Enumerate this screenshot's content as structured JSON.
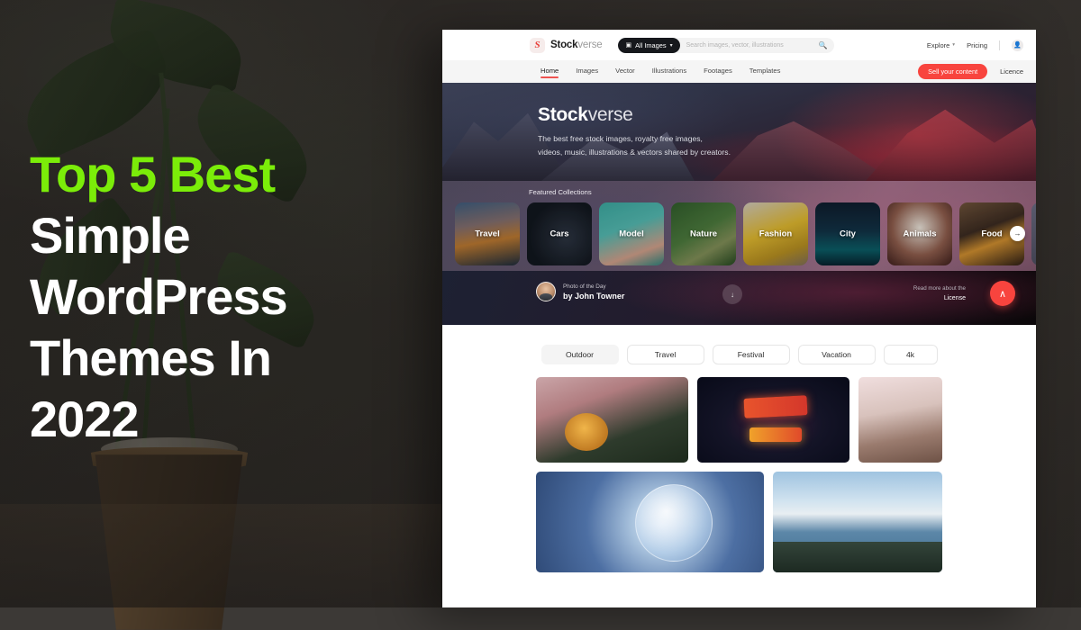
{
  "overlay": {
    "headline_line1": "Top 5 Best",
    "headline_line2": "Simple",
    "headline_line3": "WordPress",
    "headline_line4": "Themes In",
    "headline_line5": "2022",
    "accent_color": "#7bed09",
    "text_color": "#ffffff"
  },
  "site": {
    "brand_bold": "Stock",
    "brand_light": "verse",
    "logo_glyph": "S"
  },
  "search": {
    "category_label": "All Images",
    "category_icon": "camera-icon",
    "caret_icon": "▾",
    "placeholder": "Search images, vector, illustrations",
    "search_icon": "⚲"
  },
  "topbar": {
    "explore_label": "Explore",
    "pricing_label": "Pricing",
    "account_icon": "user-icon",
    "caret_icon": "▾"
  },
  "nav": {
    "items": [
      {
        "label": "Home",
        "active": true
      },
      {
        "label": "Images",
        "active": false
      },
      {
        "label": "Vector",
        "active": false
      },
      {
        "label": "Illustrations",
        "active": false
      },
      {
        "label": "Footages",
        "active": false
      },
      {
        "label": "Templates",
        "active": false
      }
    ],
    "sell_button": "Sell your content",
    "licence_link": "Licence",
    "accent_color": "#f8443e"
  },
  "hero": {
    "title_bold": "Stock",
    "title_thin": "verse",
    "subtitle_line1": "The best free stock images, royalty free images,",
    "subtitle_line2": "videos, music, illustrations & vectors shared by creators."
  },
  "collections": {
    "label": "Featured Collections",
    "next_icon": "→",
    "items": [
      {
        "caption": "Travel"
      },
      {
        "caption": "Cars"
      },
      {
        "caption": "Model"
      },
      {
        "caption": "Nature"
      },
      {
        "caption": "Fashion"
      },
      {
        "caption": "City"
      },
      {
        "caption": "Animals"
      },
      {
        "caption": "Food"
      }
    ]
  },
  "photo_of_day": {
    "kicker": "Photo of the Day",
    "author": "by John Towner",
    "download_icon": "↓",
    "read_more": "Read more about the",
    "licence": "License",
    "scroll_up_icon": "∧"
  },
  "filters": {
    "chips": [
      {
        "label": "Outdoor",
        "active": true
      },
      {
        "label": "Travel",
        "active": false
      },
      {
        "label": "Festival",
        "active": false
      },
      {
        "label": "Vacation",
        "active": false
      },
      {
        "label": "4k",
        "active": false
      }
    ]
  },
  "grid": {
    "row1": [
      {
        "alt": "woman pouring latte art into orange cup"
      },
      {
        "alt": "Harley-Davidson Cafe neon sign at night"
      },
      {
        "alt": "smiling woman in white shirt outdoors"
      }
    ],
    "row2": [
      {
        "alt": "frozen soap bubble with ice crystals"
      },
      {
        "alt": "boots resting by mountain lake"
      }
    ]
  }
}
